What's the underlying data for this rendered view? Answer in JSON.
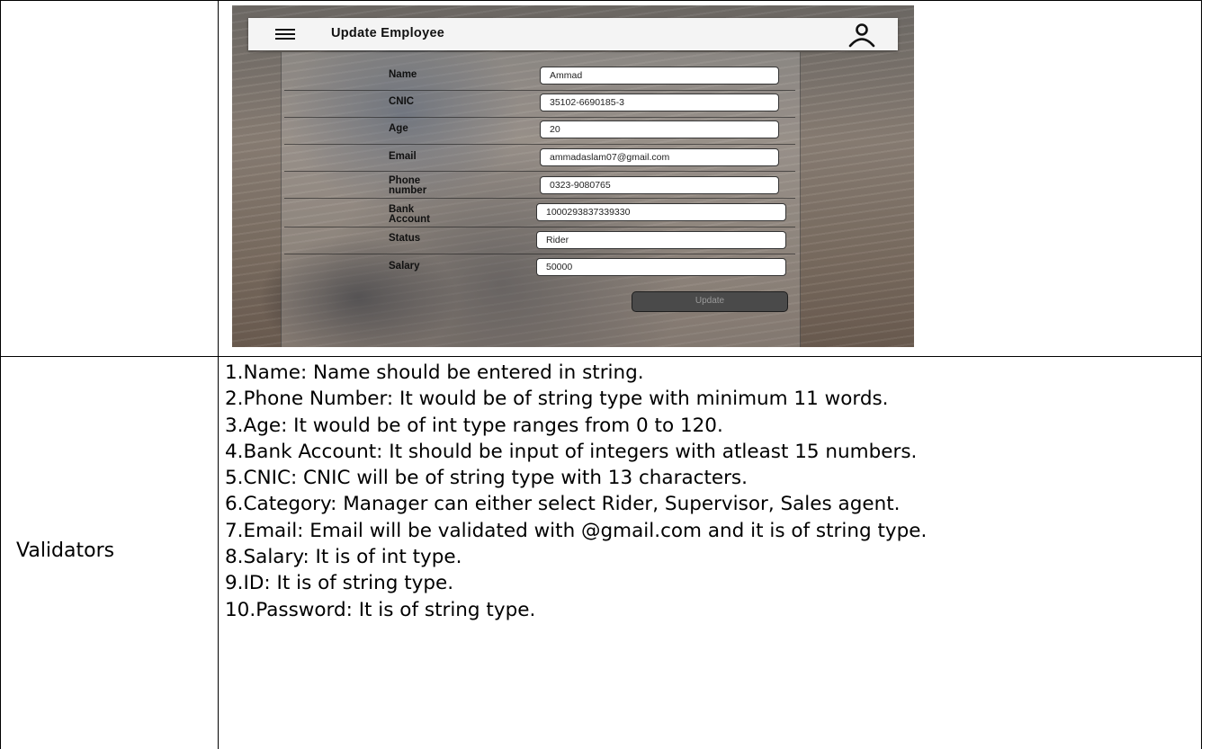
{
  "mockup": {
    "title": "Update Employee",
    "fields": [
      {
        "label": "Name",
        "value": "Ammad"
      },
      {
        "label": "CNIC",
        "value": "35102-6690185-3"
      },
      {
        "label": "Age",
        "value": "20"
      },
      {
        "label": "Email",
        "value": "ammadaslam07@gmail.com"
      },
      {
        "label": "Phone number",
        "value": "0323-9080765"
      },
      {
        "label": "Bank Account",
        "value": "1000293837339330"
      },
      {
        "label": "Status",
        "value": "Rider"
      },
      {
        "label": "Salary",
        "value": "50000"
      }
    ],
    "update_label": "Update"
  },
  "validators": {
    "label": "Validators",
    "items": [
      "1.Name: Name should be entered in string.",
      "2.Phone Number: It would be of string type with minimum 11 words.",
      "3.Age: It would be of int type ranges from 0 to 120.",
      "4.Bank Account: It should be input of integers with atleast 15 numbers.",
      "5.CNIC: CNIC will be of string type with 13 characters.",
      "6.Category: Manager can either select Rider, Supervisor, Sales agent.",
      "7.Email: Email will be validated with @gmail.com and it is of string type.",
      "8.Salary: It is of int type.",
      "9.ID: It is of string type.",
      "10.Password: It is of string type."
    ]
  }
}
